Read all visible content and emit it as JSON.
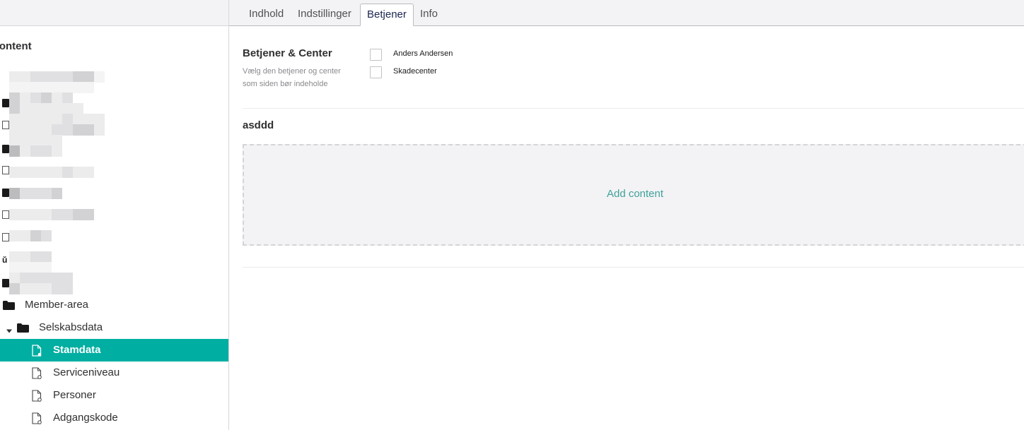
{
  "sidebar": {
    "title": "Content",
    "items": [
      {
        "label": "Member-area",
        "icon": "folder-icon"
      },
      {
        "label": "Selskabsdata",
        "icon": "folder-icon",
        "expanded": true
      },
      {
        "label": "Stamdata",
        "icon": "document-icon",
        "selected": true
      },
      {
        "label": "Serviceniveau",
        "icon": "document-icon"
      },
      {
        "label": "Personer",
        "icon": "document-icon"
      },
      {
        "label": "Adgangskode",
        "icon": "document-icon"
      }
    ]
  },
  "tabs": [
    {
      "label": "Indhold"
    },
    {
      "label": "Indstillinger"
    },
    {
      "label": "Betjener",
      "active": true
    },
    {
      "label": "Info"
    }
  ],
  "property": {
    "title": "Betjener & Center",
    "description": "Vælg den betjener og center som siden bør indeholde",
    "options": [
      {
        "label": "Anders Andersen",
        "checked": false
      },
      {
        "label": "Skadecenter",
        "checked": false
      }
    ]
  },
  "grid": {
    "title": "asddd",
    "add_label": "Add content"
  },
  "colors": {
    "accent": "#00aea2",
    "link": "#3fa19a",
    "tabbar": "#f3f3f5"
  }
}
